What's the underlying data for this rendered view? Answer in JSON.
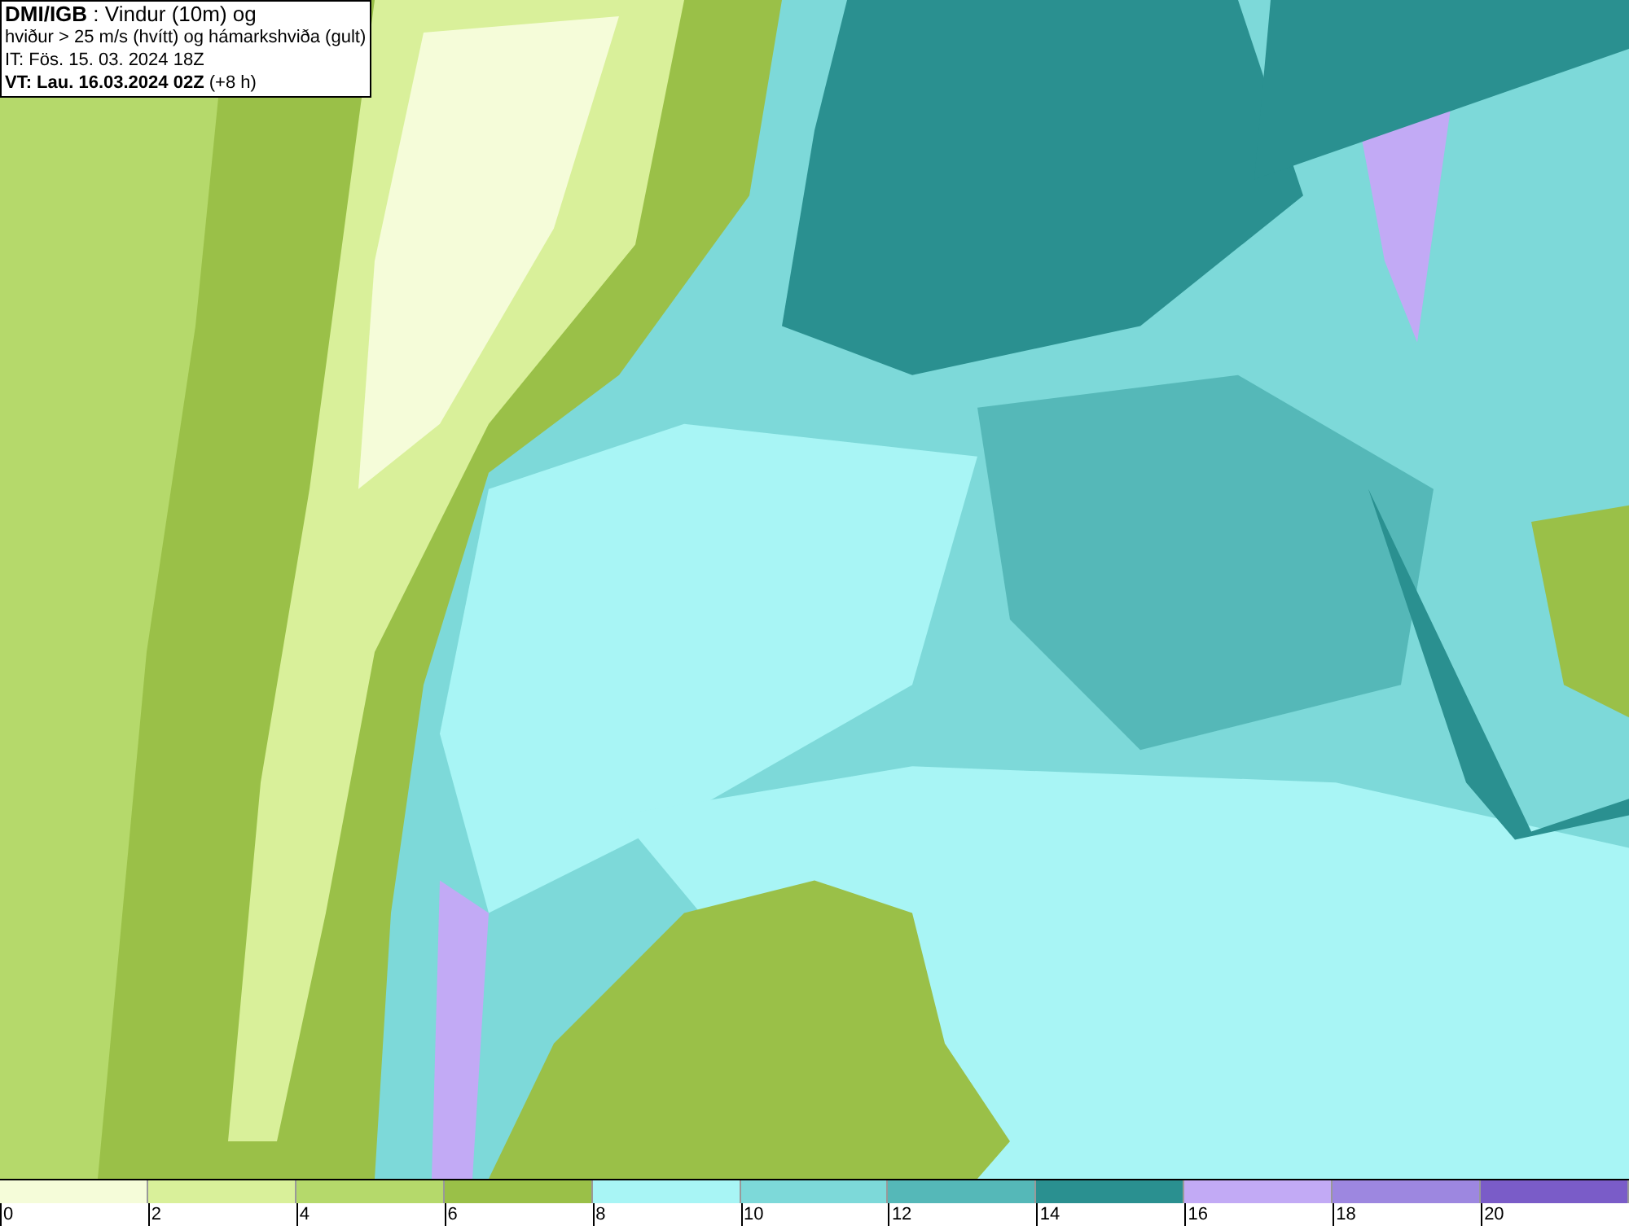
{
  "info_box": {
    "lines": [
      "**DMI/IGB** : Vindur (10m) og",
      "hviður > 25 m/s (hvítt) og hámarkshviða (gult)",
      "IT: Fös. 15. 03. 2024 18Z",
      "**VT: Lau. 16.03.2024 02Z** (+8 h)"
    ]
  },
  "legend": [
    {
      "label": "0",
      "color": "#f5fcd9"
    },
    {
      "label": "2",
      "color": "#d9f09a"
    },
    {
      "label": "4",
      "color": "#b5d96b"
    },
    {
      "label": "6",
      "color": "#9ac048"
    },
    {
      "label": "8",
      "color": "#a8f5f5"
    },
    {
      "label": "10",
      "color": "#7dd9d9"
    },
    {
      "label": "12",
      "color": "#55b8b8"
    },
    {
      "label": "14",
      "color": "#2a9090"
    },
    {
      "label": "16",
      "color": "#c2aaf5"
    },
    {
      "label": "18",
      "color": "#9d87e0"
    },
    {
      "label": "20",
      "color": "#7a5cc8"
    }
  ]
}
